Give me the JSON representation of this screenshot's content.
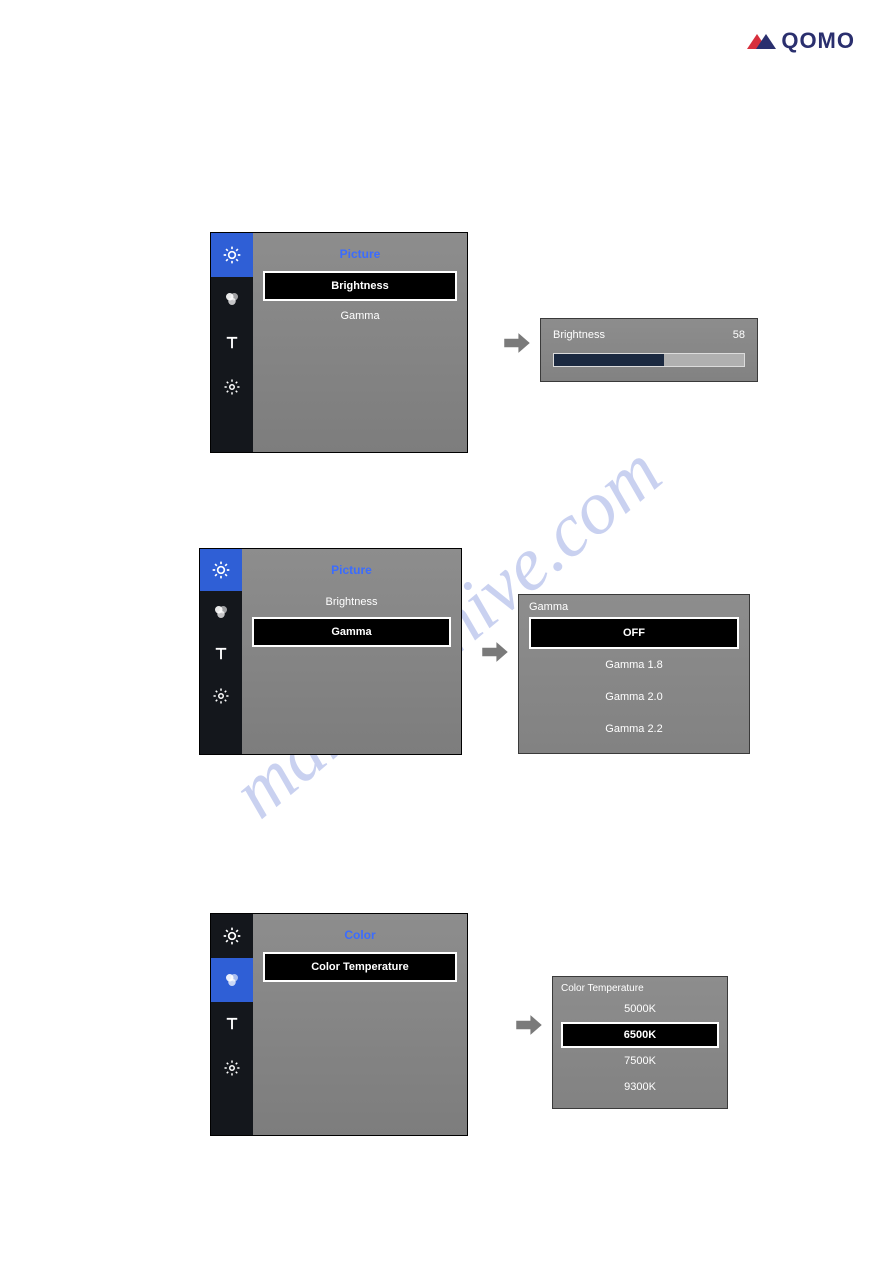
{
  "logo_text": "QOMO",
  "watermark": "manualshive.com",
  "row1": {
    "menu_title": "Picture",
    "items": [
      "Brightness",
      "Gamma"
    ],
    "selected_index": 0,
    "popout": {
      "label": "Brightness",
      "value": "58",
      "percent": 58
    }
  },
  "row2": {
    "menu_title": "Picture",
    "items": [
      "Brightness",
      "Gamma"
    ],
    "selected_index": 1,
    "popout": {
      "title": "Gamma",
      "options": [
        "OFF",
        "Gamma 1.8",
        "Gamma 2.0",
        "Gamma 2.2"
      ],
      "selected_index": 0
    }
  },
  "row3": {
    "menu_title": "Color",
    "items": [
      "Color Temperature"
    ],
    "selected_index": 0,
    "popout": {
      "title": "Color Temperature",
      "options": [
        "5000K",
        "6500K",
        "7500K",
        "9300K"
      ],
      "selected_index": 1
    }
  }
}
